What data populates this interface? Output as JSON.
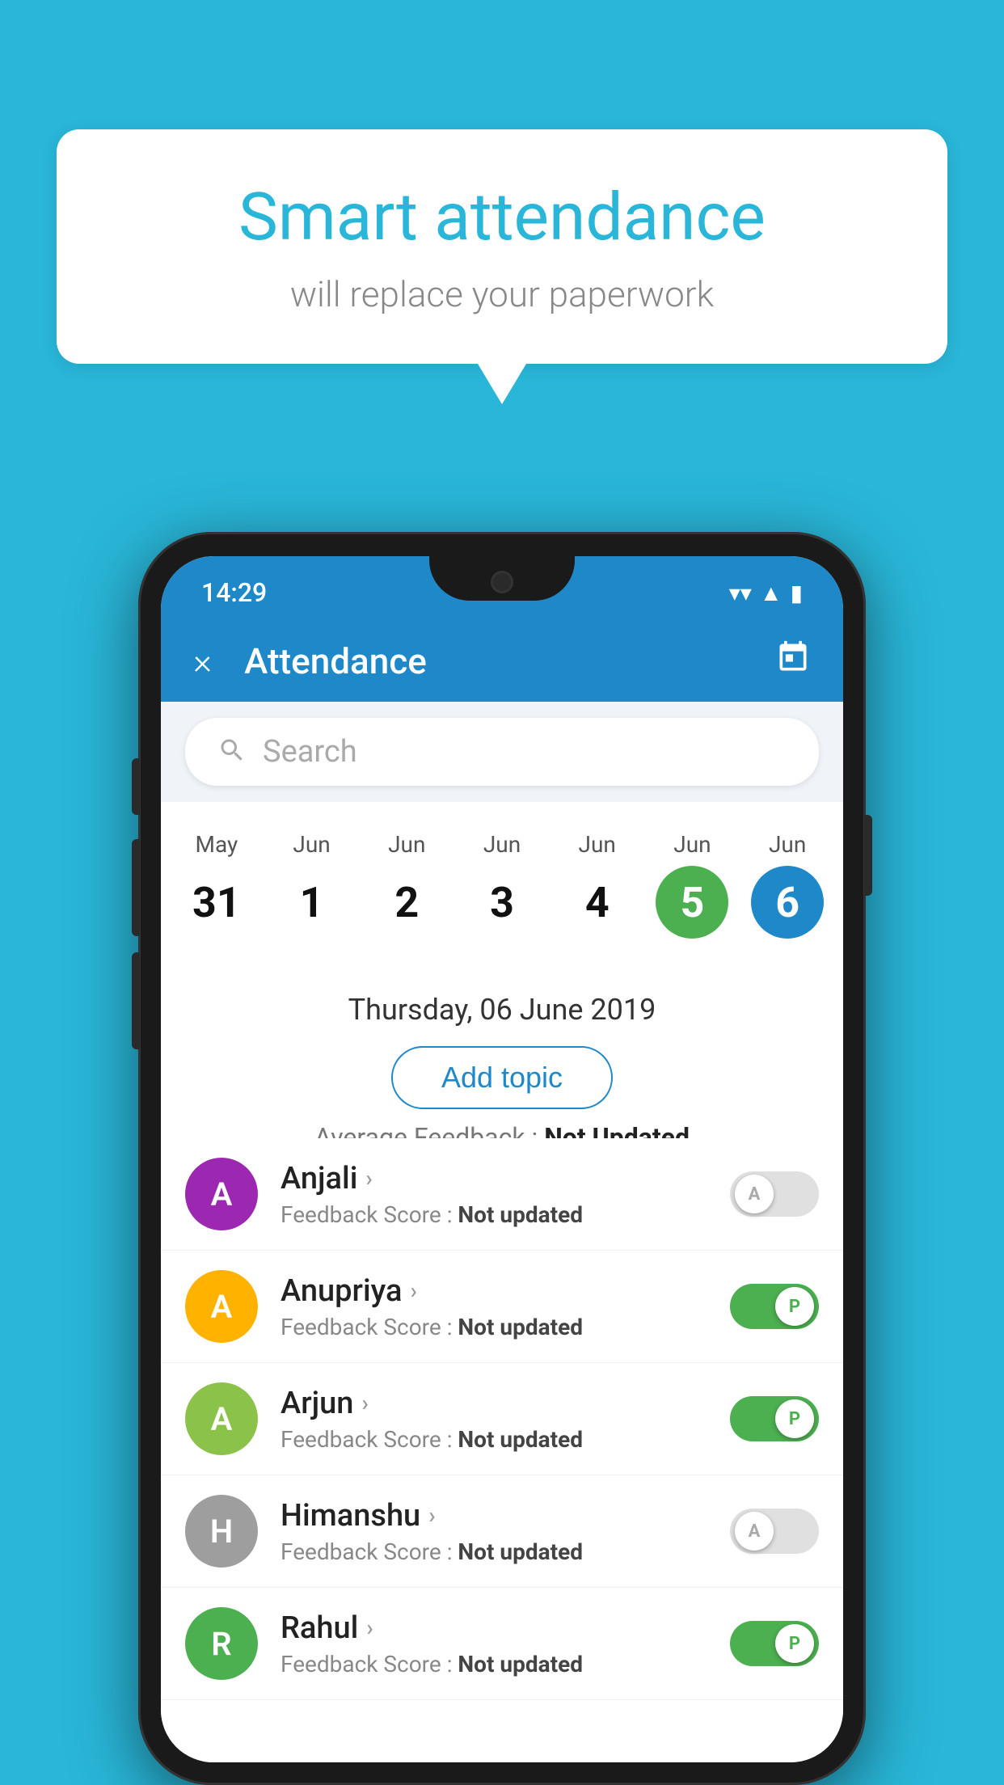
{
  "background": "#29b6d8",
  "speech_bubble": {
    "title": "Smart attendance",
    "subtitle": "will replace your paperwork"
  },
  "status_bar": {
    "time": "14:29",
    "wifi": "▼",
    "signal": "▲",
    "battery": "▮"
  },
  "header": {
    "title": "Attendance",
    "close_label": "×",
    "calendar_icon": "calendar-icon"
  },
  "search": {
    "placeholder": "Search"
  },
  "calendar": {
    "dates": [
      {
        "month": "May",
        "day": "31",
        "style": "normal"
      },
      {
        "month": "Jun",
        "day": "1",
        "style": "normal"
      },
      {
        "month": "Jun",
        "day": "2",
        "style": "normal"
      },
      {
        "month": "Jun",
        "day": "3",
        "style": "normal"
      },
      {
        "month": "Jun",
        "day": "4",
        "style": "normal"
      },
      {
        "month": "Jun",
        "day": "5",
        "style": "today"
      },
      {
        "month": "Jun",
        "day": "6",
        "style": "selected"
      }
    ]
  },
  "selected_date": "Thursday, 06 June 2019",
  "add_topic_label": "Add topic",
  "avg_feedback_label": "Average Feedback : ",
  "avg_feedback_value": "Not Updated",
  "students": [
    {
      "name": "Anjali",
      "avatar_letter": "A",
      "avatar_color": "#9c27b0",
      "feedback_label": "Feedback Score : ",
      "feedback_value": "Not updated",
      "toggle": "off",
      "toggle_label": "A"
    },
    {
      "name": "Anupriya",
      "avatar_letter": "A",
      "avatar_color": "#ffb300",
      "feedback_label": "Feedback Score : ",
      "feedback_value": "Not updated",
      "toggle": "on",
      "toggle_label": "P"
    },
    {
      "name": "Arjun",
      "avatar_letter": "A",
      "avatar_color": "#8bc34a",
      "feedback_label": "Feedback Score : ",
      "feedback_value": "Not updated",
      "toggle": "on",
      "toggle_label": "P"
    },
    {
      "name": "Himanshu",
      "avatar_letter": "H",
      "avatar_color": "#9e9e9e",
      "feedback_label": "Feedback Score : ",
      "feedback_value": "Not updated",
      "toggle": "off",
      "toggle_label": "A"
    },
    {
      "name": "Rahul",
      "avatar_letter": "R",
      "avatar_color": "#4caf50",
      "feedback_label": "Feedback Score : ",
      "feedback_value": "Not updated",
      "toggle": "on",
      "toggle_label": "P"
    }
  ]
}
